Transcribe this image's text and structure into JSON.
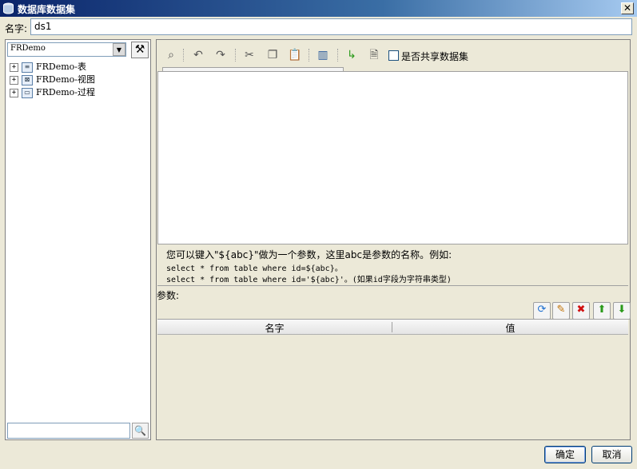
{
  "window": {
    "title": "数据库数据集",
    "close_glyph": "✕"
  },
  "name_field": {
    "label": "名字:",
    "value": "ds1"
  },
  "connection": {
    "selected": "FRDemo",
    "dropdown_glyph": "▼",
    "tool_glyph": "⚒"
  },
  "tree": {
    "items": [
      {
        "expander": "+",
        "icon": "table-icon",
        "label": "FRDemo-表"
      },
      {
        "expander": "+",
        "icon": "view-icon",
        "label": "FRDemo-视图"
      },
      {
        "expander": "+",
        "icon": "procedure-icon",
        "label": "FRDemo-过程"
      }
    ],
    "search_glyph": "🔍"
  },
  "toolbar": {
    "share_label": "是否共享数据集"
  },
  "hint": {
    "line1": "您可以键入\"${abc}\"做为一个参数，这里abc是参数的名称。例如:",
    "line2": "select * from table where id=${abc}。",
    "line3": "select * from table where id='${abc}'。(如果id字段为字符串类型)"
  },
  "params": {
    "label": "参数:",
    "columns": [
      "名字",
      "值"
    ],
    "buttons": [
      {
        "name": "refresh-icon",
        "glyph": "⟳",
        "color": "#1e6fd0"
      },
      {
        "name": "edit-icon",
        "glyph": "✎",
        "color": "#c07000"
      },
      {
        "name": "delete-icon",
        "glyph": "✖",
        "color": "#d01010"
      },
      {
        "name": "move-up-icon",
        "glyph": "⬆",
        "color": "#2a9a1a"
      },
      {
        "name": "move-down-icon",
        "glyph": "⬇",
        "color": "#2a9a1a"
      }
    ]
  },
  "footer": {
    "ok_label": "确定",
    "cancel_label": "取消"
  }
}
